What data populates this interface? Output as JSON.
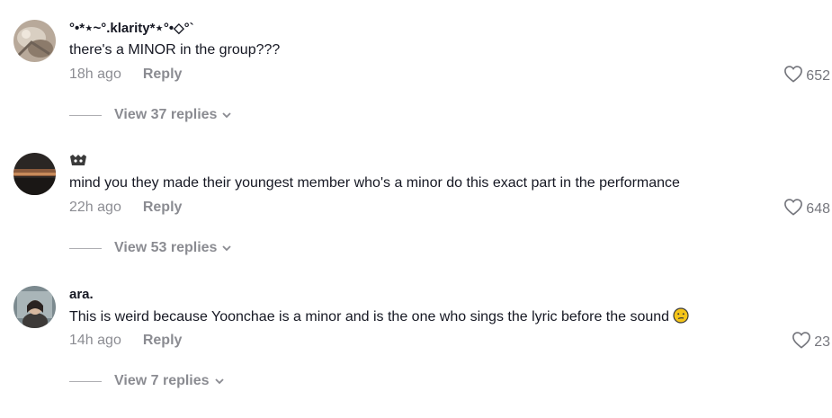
{
  "comments": [
    {
      "username": "°•*⋆~°.klarity*⋆°•◇°`",
      "text": "there's a MINOR in the group???",
      "time": "18h ago",
      "reply_label": "Reply",
      "likes": "652",
      "view_replies": "View 37 replies",
      "avatar_icon": "avatar-photo"
    },
    {
      "username": "",
      "username_icon": "emote-icon",
      "text": "mind you they made their youngest member who's a minor do this exact part in the performance",
      "time": "22h ago",
      "reply_label": "Reply",
      "likes": "648",
      "view_replies": "View 53 replies",
      "avatar_icon": "avatar-photo"
    },
    {
      "username": "ara.",
      "text": "This is weird because Yoonchae is a minor and is the one who sings the lyric before the sound",
      "text_emoji": "confused-face-emoji",
      "time": "14h ago",
      "reply_label": "Reply",
      "likes": "23",
      "view_replies": "View 7 replies",
      "avatar_icon": "avatar-photo"
    }
  ],
  "colors": {
    "text_primary": "#161823",
    "text_secondary": "rgba(22,24,35,0.5)",
    "emoji_yellow": "#f5c518"
  }
}
